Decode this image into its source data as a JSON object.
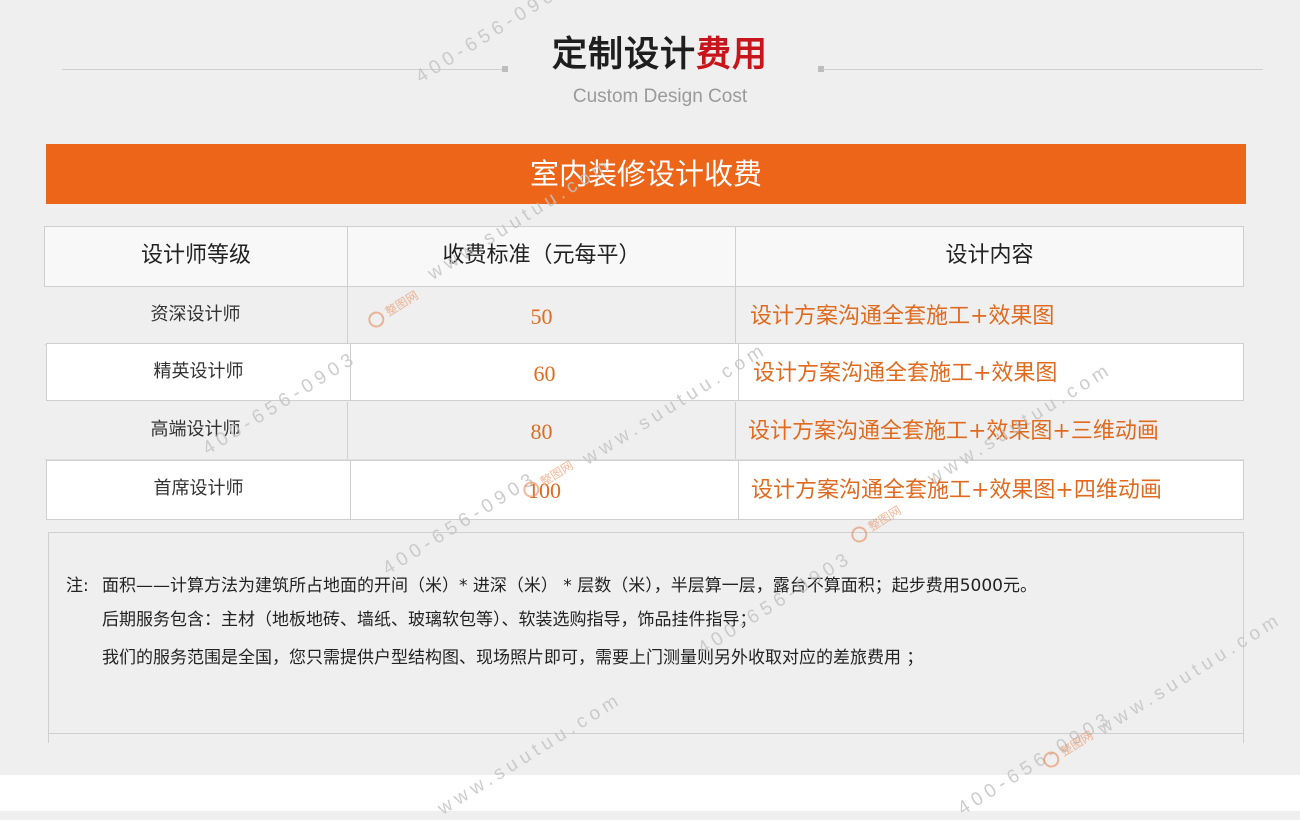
{
  "header": {
    "title_main": "定制设计",
    "title_accent": "费用",
    "subtitle": "Custom Design Cost"
  },
  "banner": {
    "label": "室内装修设计收费"
  },
  "table": {
    "columns": [
      "设计师等级",
      "收费标准（元每平）",
      "设计内容"
    ],
    "rows": [
      {
        "level": "资深设计师",
        "price": "50",
        "content": "设计方案沟通全套施工+效果图"
      },
      {
        "level": "精英设计师",
        "price": "60",
        "content": "设计方案沟通全套施工+效果图"
      },
      {
        "level": "高端设计师",
        "price": "80",
        "content": "设计方案沟通全套施工+效果图+三维动画"
      },
      {
        "level": "首席设计师",
        "price": "100",
        "content": "设计方案沟通全套施工+效果图+四维动画"
      }
    ]
  },
  "notes": {
    "label": "注:",
    "lines": [
      "面积——计算方法为建筑所占地面的开间（米）* 进深（米） * 层数（米），半层算一层，露台不算面积；起步费用5000元。",
      "后期服务包含：主材（地板地砖、墙纸、玻璃软包等）、软装选购指导，饰品挂件指导；",
      "我们的服务范围是全国，您只需提供户型结构图、现场照片即可，需要上门测量则另外收取对应的差旅费用 ；"
    ]
  },
  "watermarks": {
    "phone": "400-656-0903",
    "site": "www.suutuu.com",
    "logo_text": "整图网"
  },
  "colors": {
    "accent_red": "#c8151b",
    "banner_orange": "#ec6518",
    "value_orange": "#e06a1e"
  }
}
